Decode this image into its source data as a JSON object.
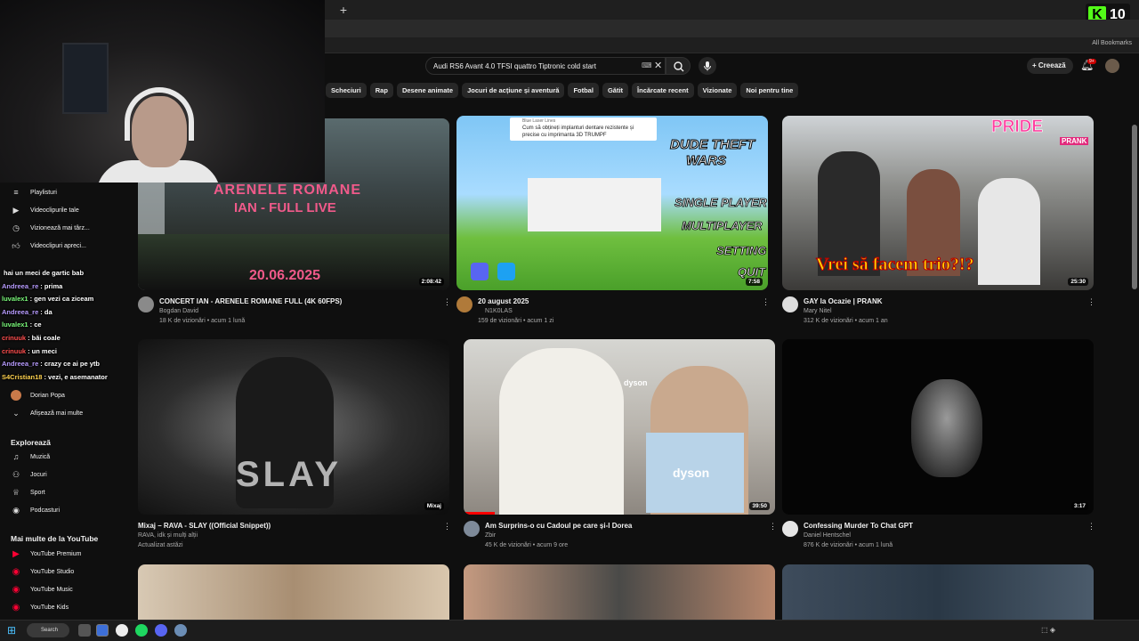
{
  "browser": {
    "all_bookmarks": "All Bookmarks",
    "new_tab_symbol": "+"
  },
  "kick_badge": {
    "letter": "K",
    "count": "10"
  },
  "header": {
    "search_value": "Audi RS6 Avant 4.0 TFSI quattro Tiptronic cold start",
    "create_label": "Creează",
    "notifications_badge": "9+"
  },
  "chips": [
    "Scheciuri",
    "Rap",
    "Desene animate",
    "Jocuri de acțiune și aventură",
    "Fotbal",
    "Gătit",
    "Încărcate recent",
    "Vizionate",
    "Noi pentru tine"
  ],
  "sidebar": {
    "top_items": [
      {
        "label": "Playlisturi",
        "icon": "playlist-icon"
      },
      {
        "label": "Videoclipurile tale",
        "icon": "your-videos-icon"
      },
      {
        "label": "Vizionează mai târz...",
        "icon": "watch-later-icon"
      },
      {
        "label": "Videoclipuri apreci...",
        "icon": "liked-icon"
      }
    ],
    "subscription": {
      "label": "Dorian Popa"
    },
    "show_more": "Afișează mai multe",
    "explore_heading": "Explorează",
    "explore_items": [
      {
        "label": "Muzică",
        "icon": "music-icon"
      },
      {
        "label": "Jocuri",
        "icon": "gaming-icon"
      },
      {
        "label": "Sport",
        "icon": "trophy-icon"
      },
      {
        "label": "Podcasturi",
        "icon": "podcast-icon"
      }
    ],
    "more_heading": "Mai multe de la YouTube",
    "more_items": [
      {
        "label": "YouTube Premium"
      },
      {
        "label": "YouTube Studio"
      },
      {
        "label": "YouTube Music"
      },
      {
        "label": "YouTube Kids"
      }
    ]
  },
  "chat": [
    {
      "user": "",
      "text": "hai un meci de gartic bab",
      "color": "#ff4f4f"
    },
    {
      "user": "Andreea_re",
      "text": ": prima",
      "color": "#b89cff"
    },
    {
      "user": "luvalex1",
      "text": ": gen vezi ca ziceam",
      "color": "#7cfc7c"
    },
    {
      "user": "Andreea_re",
      "text": ": da",
      "color": "#b89cff"
    },
    {
      "user": "luvalex1",
      "text": ": ce",
      "color": "#7cfc7c"
    },
    {
      "user": "crinuuk",
      "text": ": băi coale",
      "color": "#ff4f4f"
    },
    {
      "user": "crinuuk",
      "text": ": un meci",
      "color": "#ff4f4f"
    },
    {
      "user": "Andreea_re",
      "text": ": crazy ce ai pe ytb",
      "color": "#b89cff"
    },
    {
      "user": "S4Cristian18",
      "text": ": vezi, e asemanator",
      "color": "#ffd24f"
    }
  ],
  "videos": [
    {
      "title": "CONCERT IAN - ARENELE ROMANE FULL (4K 60FPS)",
      "channel": "Bogdan David",
      "stats": "18 K de vizionări • acum 1 lună",
      "duration": "2:08:42",
      "overlay1": "ARENELE ROMANE",
      "overlay2": "IAN - FULL LIVE",
      "overlay3": "20.06.2025"
    },
    {
      "title": "20 august 2025",
      "channel": "N1K0LAS",
      "stats": "159 de vizionări • acum 1 zi",
      "duration": "7:58",
      "ad_line1": "Blue Laser Lines",
      "ad_line2": "Cum să obțineți implanturi dentare rezistente și",
      "ad_line3": "precise cu imprimanta 3D TRUMPF",
      "overlay1": "DUDE THEFT",
      "overlay2": "WARS",
      "overlay3": "SINGLE PLAYER",
      "overlay4": "MULTIPLAYER",
      "overlay5": "SETTING",
      "overlay6": "QUIT"
    },
    {
      "title": "GAY la Ocazie | PRANK",
      "channel": "Mary Nitel",
      "stats": "312 K de vizionări • acum 1 an",
      "duration": "25:30",
      "overlay1": "Vrei să facem trio?!?",
      "overlay2": "PRIDE",
      "overlay3": "PRANK"
    },
    {
      "title": "Mixaj – RAVA - SLAY ((Official Snippet))",
      "channel": "RAVA, idk și mulți alții",
      "stats": "Actualizat astăzi",
      "duration": "Mixaj",
      "overlay1": "SLAY"
    },
    {
      "title": "Am Surprins-o cu Cadoul pe care și-l Dorea",
      "channel": "Zbir",
      "stats": "45 K de vizionări • acum 9 ore",
      "duration": "39:50",
      "overlay1": "dyson",
      "overlay2": "dyson"
    },
    {
      "title": "Confessing Murder To Chat GPT",
      "channel": "Daniel Hentschel",
      "stats": "876 K de vizionări • acum 1 lună",
      "duration": "3:17"
    }
  ],
  "taskbar": {
    "search_label": "Search"
  }
}
